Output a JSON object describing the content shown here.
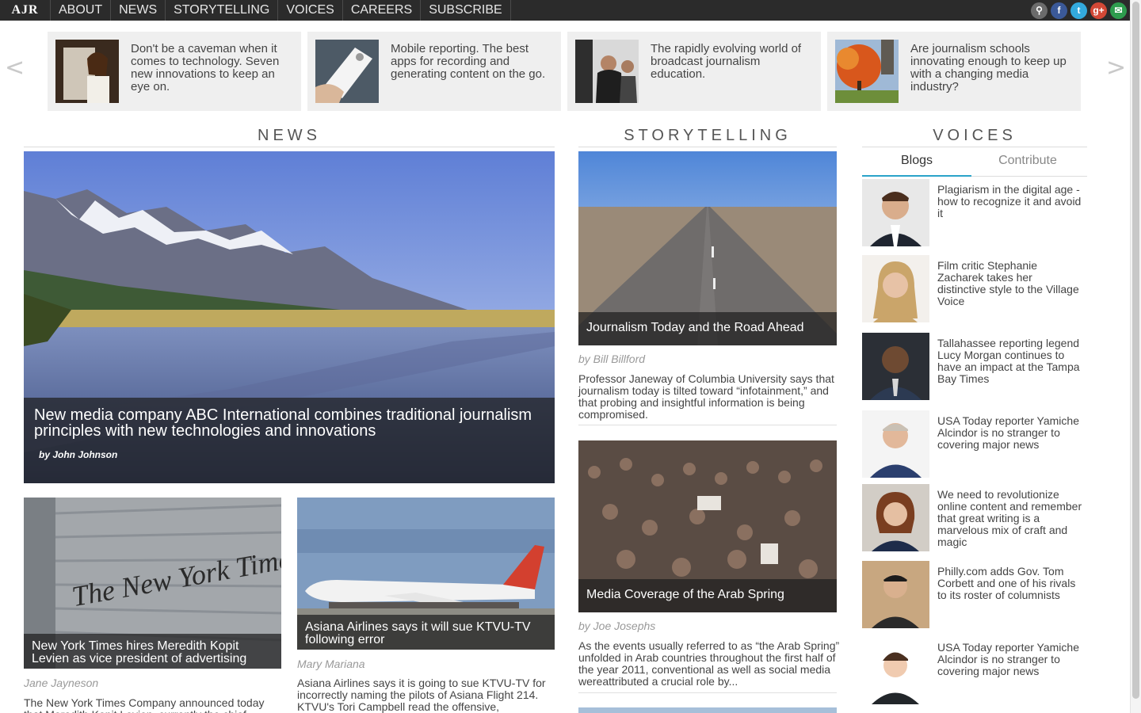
{
  "brand": {
    "logo": "AJR"
  },
  "nav": {
    "items": [
      "ABOUT",
      "NEWS",
      "STORYTELLING",
      "VOICES",
      "CAREERS",
      "SUBSCRIBE"
    ]
  },
  "social": {
    "search": "⚲",
    "facebook": "f",
    "twitter": "t",
    "googleplus": "g+",
    "email": "✉"
  },
  "carousel": {
    "prev": "<",
    "next": ">",
    "items": [
      {
        "text": "Don't be a caveman when it comes to technology. Seven new innovations to keep an eye on."
      },
      {
        "text": "Mobile reporting. The best apps for recording and generating content on the go."
      },
      {
        "text": "The rapidly evolving world of broadcast journalism education."
      },
      {
        "text": "Are journalism schools innovating enough to keep up with a changing media industry?"
      }
    ]
  },
  "news": {
    "heading": "NEWS",
    "hero": {
      "title": "New media company ABC International combines traditional journalism principles with new technologies and innovations",
      "byline": "by John Johnson"
    },
    "cards": [
      {
        "title": "New York Times hires Meredith Kopit Levien as vice president of advertising",
        "author": "Jane Jayneson",
        "blurb": "The New York Times Company announced today that Meredith Kopit Levien, currently the chief"
      },
      {
        "title": "Asiana Airlines says it will sue KTVU-TV following error",
        "author": "Mary Mariana",
        "blurb": "Asiana Airlines says it is going to sue KTVU-TV for incorrectly naming the pilots of Asiana Flight 214. KTVU's Tori Campbell read the offensive,"
      }
    ]
  },
  "storytelling": {
    "heading": "STORYTELLING",
    "stories": [
      {
        "title": "Journalism Today and the Road Ahead",
        "author": "by Bill Billford",
        "blurb": "Professor Janeway of Columbia University says that journalism today is tilted toward “infotainment,” and that probing and insightful information is being compromised."
      },
      {
        "title": "Media Coverage of the Arab Spring",
        "author": "by Joe Josephs",
        "blurb": "As the events usually referred to as “the Arab Spring” unfolded in Arab countries throughout the first half of the year 2011, conventional as well as social media wereattributed a crucial role by..."
      }
    ]
  },
  "voices": {
    "heading": "VOICES",
    "tabs": {
      "active": "Blogs",
      "inactive": "Contribute"
    },
    "items": [
      {
        "text": "Plagiarism in the digital age - how to recognize it and avoid it"
      },
      {
        "text": "Film critic Stephanie Zacharek takes her distinctive style to the Village Voice"
      },
      {
        "text": "Tallahassee reporting legend Lucy Morgan continues to have an impact at the Tampa Bay Times"
      },
      {
        "text": "USA Today reporter Yamiche Alcindor is no stranger to covering major news"
      },
      {
        "text": "We need to revolutionize online content and remember that great writing is a marvelous mix of craft and magic"
      },
      {
        "text": "Philly.com adds Gov. Tom Corbett and one of his rivals to its roster of columnists"
      },
      {
        "text": "USA Today reporter Yamiche Alcindor is no stranger to covering major news"
      }
    ]
  },
  "colors": {
    "nav_bg": "#2b2b2b",
    "tab_accent": "#2aa3c9",
    "feature_bg": "#efefef"
  }
}
